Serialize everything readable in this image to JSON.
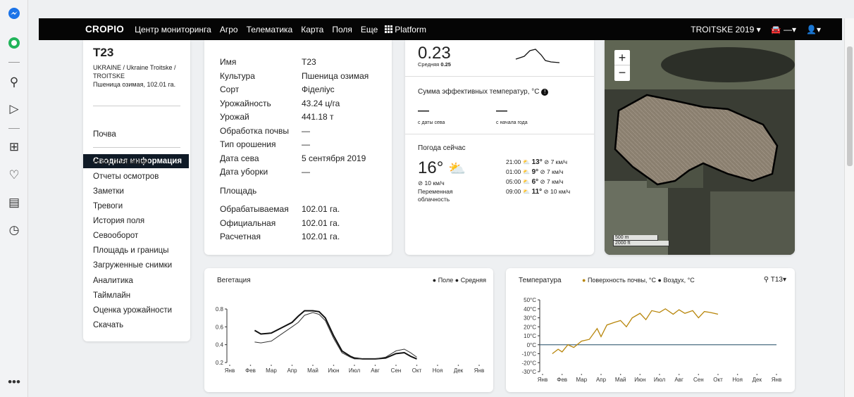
{
  "topbar": {
    "brand": "CROPIO",
    "nav": [
      "Центр мониторинга",
      "Агро",
      "Телематика",
      "Карта",
      "Поля",
      "Еще"
    ],
    "platform": "Platform",
    "season": "TROITSKE 2019 ▾",
    "vehicle": "—▾",
    "user": "▾"
  },
  "field": {
    "name": "T23",
    "location": "UKRAINE / Ukraine Troitske / TROITSKE",
    "crop_area": "Пшеница озимая, 102.01 га."
  },
  "sidebar": {
    "active": "Сводная информация",
    "soil": "Почва",
    "items": [
      "Агро операции",
      "Отчеты осмотров",
      "Заметки",
      "Тревоги",
      "История поля",
      "Севооборот",
      "Площадь и границы",
      "Загруженные снимки",
      "Аналитика",
      "Таймлайн",
      "Оценка урожайности",
      "Скачать"
    ]
  },
  "info": {
    "rows": [
      [
        "Имя",
        "T23"
      ],
      [
        "Культура",
        "Пшеница озимая"
      ],
      [
        "Сорт",
        "Фіделіус"
      ],
      [
        "Урожайность",
        "43.24 ц/га"
      ],
      [
        "Урожай",
        "441.18 т"
      ],
      [
        "Обработка почвы",
        "—"
      ],
      [
        "Тип орошения",
        "—"
      ],
      [
        "Дата сева",
        "5 сентября 2019"
      ],
      [
        "Дата уборки",
        "—"
      ]
    ],
    "area_title": "Площадь",
    "area_rows": [
      [
        "Обрабатываемая",
        "102.01 га."
      ],
      [
        "Официальная",
        "102.01 га."
      ],
      [
        "Расчетная",
        "102.01 га."
      ]
    ]
  },
  "stats": {
    "ndvi": "0.23",
    "avg_label": "Средняя",
    "avg": "0.25",
    "gdd_title": "Сумма эффективных температур, °C",
    "gdd_since_sow": "—",
    "gdd_since_sow_label": "с даты сева",
    "gdd_since_year": "—",
    "gdd_since_year_label": "с начала года",
    "weather_title": "Погода сейчас",
    "temp": "16°",
    "wind": "10 км/ч",
    "condition": "Переменная облачность",
    "forecast": [
      {
        "time": "21:00",
        "temp": "13°",
        "wind": "7 км/ч"
      },
      {
        "time": "01:00",
        "temp": "9°",
        "wind": "7 км/ч"
      },
      {
        "time": "05:00",
        "temp": "6°",
        "wind": "7 км/ч"
      },
      {
        "time": "09:00",
        "temp": "11°",
        "wind": "10 км/ч"
      }
    ]
  },
  "map": {
    "scale_m": "500 m",
    "scale_ft": "2000 ft",
    "zoom_in": "+",
    "zoom_out": "−"
  },
  "vegetation": {
    "title": "Вегетация",
    "legend_field": "Поле",
    "legend_avg": "Средняя"
  },
  "temperature": {
    "title": "Температура",
    "legend_surface": "Поверхность почвы, °C",
    "legend_air": "Воздух, °C",
    "selector": "T13▾"
  },
  "colors": {
    "accent": "#b8860b",
    "dark": "#0f1a26"
  },
  "chart_data": [
    {
      "type": "line",
      "title": "Вегетация",
      "categories": [
        "Янв",
        "Фев",
        "Мар",
        "Апр",
        "Май",
        "Июн",
        "Июл",
        "Авг",
        "Сен",
        "Окт",
        "Ноя",
        "Дек",
        "Янв"
      ],
      "ylim": [
        0.2,
        0.8
      ],
      "yticks": [
        "0.8",
        "0.6",
        "0.4",
        "0.2"
      ],
      "series": [
        {
          "name": "Поле",
          "x": [
            1.2,
            1.5,
            2,
            2.5,
            3,
            3.3,
            3.6,
            4,
            4.3,
            4.6,
            5,
            5.4,
            5.8,
            6,
            6.4,
            7,
            7.5,
            8,
            8.4,
            8.7,
            9
          ],
          "values": [
            0.56,
            0.52,
            0.53,
            0.59,
            0.65,
            0.72,
            0.78,
            0.78,
            0.77,
            0.7,
            0.5,
            0.33,
            0.27,
            0.25,
            0.24,
            0.24,
            0.25,
            0.3,
            0.31,
            0.27,
            0.24
          ]
        },
        {
          "name": "Средняя",
          "x": [
            1.2,
            1.5,
            2,
            2.5,
            3,
            3.3,
            3.6,
            4,
            4.3,
            4.6,
            5,
            5.4,
            5.8,
            6,
            6.4,
            7,
            7.5,
            8,
            8.4,
            8.7,
            9
          ],
          "values": [
            0.43,
            0.42,
            0.44,
            0.52,
            0.6,
            0.65,
            0.73,
            0.76,
            0.74,
            0.67,
            0.47,
            0.31,
            0.26,
            0.24,
            0.24,
            0.24,
            0.26,
            0.33,
            0.35,
            0.31,
            0.26
          ]
        }
      ]
    },
    {
      "type": "line",
      "title": "Температура",
      "categories": [
        "Янв",
        "Фев",
        "Мар",
        "Апр",
        "Май",
        "Июн",
        "Июл",
        "Авг",
        "Сен",
        "Окт",
        "Ноя",
        "Дек",
        "Янв"
      ],
      "ylim": [
        -30,
        50
      ],
      "yticks": [
        "50°C",
        "40°C",
        "30°C",
        "20°C",
        "10°C",
        "0°C",
        "-10°C",
        "-20°C",
        "-30°C"
      ],
      "series": [
        {
          "name": "Поверхность почвы, °C",
          "x": [
            0.5,
            0.8,
            1,
            1.3,
            1.6,
            2,
            2.4,
            2.8,
            3,
            3.3,
            3.7,
            4,
            4.3,
            4.6,
            5,
            5.3,
            5.6,
            6,
            6.3,
            6.7,
            7,
            7.3,
            7.7,
            8,
            8.3,
            8.6,
            9
          ],
          "values": [
            -10,
            -5,
            -8,
            0,
            -3,
            4,
            6,
            18,
            9,
            22,
            25,
            27,
            20,
            30,
            35,
            28,
            38,
            36,
            40,
            34,
            39,
            35,
            38,
            30,
            37,
            36,
            34
          ]
        }
      ]
    }
  ]
}
